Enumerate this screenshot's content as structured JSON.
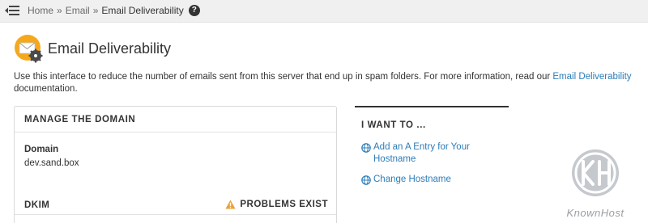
{
  "breadcrumb": {
    "home": "Home",
    "sep1": "»",
    "email": "Email",
    "sep2": "»",
    "current": "Email Deliverability",
    "help": "?"
  },
  "header": {
    "title": "Email Deliverability",
    "icon": "email-deliverability-icon"
  },
  "intro": {
    "text": "Use this interface to reduce the number of emails sent from this server that end up in spam folders. For more information, read our ",
    "link": "Email Deliverability",
    "tail": "documentation."
  },
  "manage": {
    "heading": "MANAGE THE DOMAIN",
    "domain_label": "Domain",
    "domain_value": "dev.sand.box",
    "dkim_label": "DKIM",
    "dkim_status": "PROBLEMS EXIST",
    "warning_color": "#e9a23b"
  },
  "sidebar": {
    "heading": "I WANT TO ...",
    "links": [
      {
        "label": "Add an A Entry for Your Hostname",
        "icon": "globe-icon"
      },
      {
        "label": "Change Hostname",
        "icon": "globe-icon"
      }
    ]
  },
  "watermark": {
    "text": "KnownHost",
    "logo": "knownhost-logo"
  },
  "colors": {
    "link": "#2c7db7",
    "topbar": "#f0f0f0",
    "icon_orange": "#f5a81c"
  }
}
